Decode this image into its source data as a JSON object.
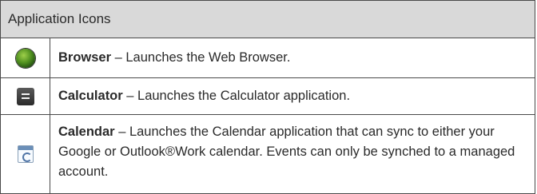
{
  "table": {
    "header": "Application Icons",
    "rows": [
      {
        "icon": "browser-globe-icon",
        "name": "Browser",
        "desc": " – Launches the Web Browser."
      },
      {
        "icon": "calculator-icon",
        "name": "Calculator",
        "desc": " – Launches the Calculator application."
      },
      {
        "icon": "calendar-icon",
        "name": "Calendar",
        "desc": " – Launches the Calendar application that can sync to either your Google or Outlook®Work calendar. Events can only be synched to a managed account."
      }
    ]
  }
}
